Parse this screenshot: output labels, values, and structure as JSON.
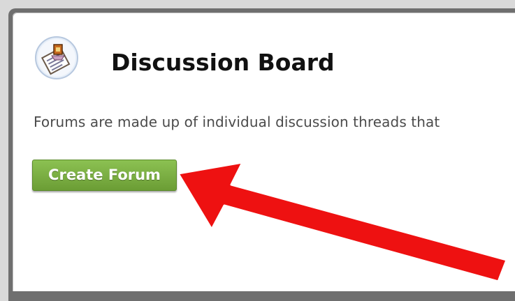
{
  "page": {
    "title": "Discussion Board",
    "description": "Forums are made up of individual discussion threads that",
    "icon": "discussion-board-icon"
  },
  "actions": {
    "create_forum_label": "Create Forum"
  },
  "annotation": {
    "arrow_color": "#ee1111"
  },
  "colors": {
    "button_green": "#7ab040",
    "frame_gray": "#6f6f6f"
  }
}
